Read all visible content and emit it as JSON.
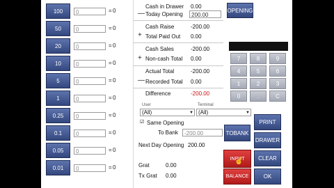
{
  "denominations": [
    {
      "label": "100",
      "input": "0",
      "eq": "=",
      "result": "0"
    },
    {
      "label": "50",
      "input": "0",
      "eq": "=",
      "result": "0"
    },
    {
      "label": "20",
      "input": "0",
      "eq": "=",
      "result": "0"
    },
    {
      "label": "10",
      "input": "0",
      "eq": "=",
      "result": "0"
    },
    {
      "label": "5",
      "input": "0",
      "eq": "=",
      "result": "0"
    },
    {
      "label": "1",
      "input": "0",
      "eq": "=",
      "result": "0"
    },
    {
      "label": "0.25",
      "input": "0",
      "eq": "=",
      "result": "0"
    },
    {
      "label": "0.1",
      "input": "0",
      "eq": "=",
      "result": "0"
    },
    {
      "label": "0.05",
      "input": "0",
      "eq": "=",
      "result": "0"
    },
    {
      "label": "0.01",
      "input": "0",
      "eq": "=",
      "result": "0"
    }
  ],
  "summary": {
    "cash_in_drawer_label": "Cash in Drawer",
    "cash_in_drawer_value": "0.00",
    "minus1": "—",
    "today_opening_label": "Today Opening",
    "today_opening_value": "200.00",
    "opening_button": "OPENING",
    "cash_raise_label": "Cash Raise",
    "cash_raise_value": "-200.00",
    "plus1": "+",
    "total_paid_out_label": "Total Paid Out",
    "total_paid_out_value": "0.00",
    "cash_sales_label": "Cash Sales",
    "cash_sales_value": "-200.00",
    "plus2": "+",
    "non_cash_total_label": "Non-cash Total",
    "non_cash_total_value": "0.00",
    "actual_total_label": "Actual Total",
    "actual_total_value": "-200.00",
    "minus2": "—",
    "recorded_total_label": "Recorded Total",
    "recorded_total_value": "0.00",
    "difference_label": "Difference",
    "difference_value": "-200.00",
    "difference_color": "#d01010"
  },
  "filters": {
    "user_label": "User",
    "user_value": "(All)",
    "terminal_label": "Terminal",
    "terminal_value": "(All)"
  },
  "same_opening": {
    "checkbox": "☑",
    "label": "Same Opening"
  },
  "to_bank": {
    "label": "To Bank",
    "value": "-200.00",
    "button": "TOBANK"
  },
  "next_day": {
    "label": "Next Day Opening",
    "value": "200.00"
  },
  "grat": {
    "label": "Grat",
    "value": "0.00"
  },
  "tx_grat": {
    "label": "Tx Grat",
    "value": "0.00"
  },
  "keypad": {
    "row1": [
      "7",
      "8",
      "9"
    ],
    "row2": [
      "4",
      "5",
      "6"
    ],
    "row3": [
      "1",
      "2",
      "3"
    ],
    "row4": [
      "0",
      ".",
      "C"
    ]
  },
  "actions": {
    "print": "PRINT",
    "drawer": "DRAWER",
    "clear": "CLEAR",
    "ok": "OK",
    "red_top": "INPUT",
    "balance": "BALANCE"
  },
  "colors": {
    "blue_btn": "#3f5590",
    "red_btn": "#c82828",
    "keypad": "#b5b8c2"
  }
}
